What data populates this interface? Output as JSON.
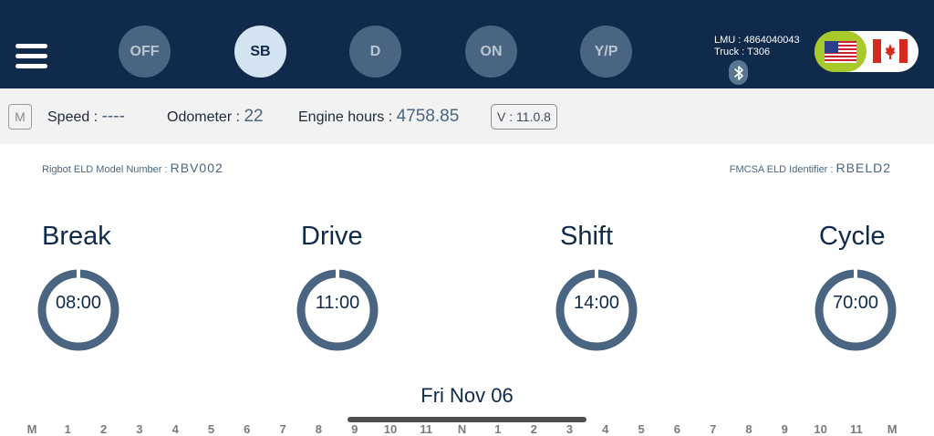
{
  "header": {
    "statuses": [
      {
        "label": "OFF",
        "active": false
      },
      {
        "label": "SB",
        "active": true
      },
      {
        "label": "D",
        "active": false
      },
      {
        "label": "ON",
        "active": false
      },
      {
        "label": "Y/P",
        "active": false
      }
    ],
    "lmu": "LMU : 4864040043",
    "truck": "Truck : T306",
    "colors": {
      "bar": "#0f2a4a",
      "active_flag_bg": "#a7c92a"
    }
  },
  "infobar": {
    "m_label": "M",
    "speed_label": "Speed :",
    "speed_value": "----",
    "odometer_label": "Odometer :",
    "odometer_value": "22",
    "engine_label": "Engine hours :",
    "engine_value": "4758.85",
    "version": "V : 11.0.8"
  },
  "model": {
    "model_label": "Rigbot ELD Model Number :",
    "model_value": "RBV002",
    "fmcsa_label": "FMCSA ELD Identifier :",
    "fmcsa_value": "RBELD2"
  },
  "clocks": [
    {
      "title": "Break",
      "value": "08:00"
    },
    {
      "title": "Drive",
      "value": "11:00"
    },
    {
      "title": "Shift",
      "value": "14:00"
    },
    {
      "title": "Cycle",
      "value": "70:00"
    }
  ],
  "date": "Fri Nov 06",
  "hours": [
    "M",
    "1",
    "2",
    "3",
    "4",
    "5",
    "6",
    "7",
    "8",
    "9",
    "10",
    "11",
    "N",
    "1",
    "2",
    "3",
    "4",
    "5",
    "6",
    "7",
    "8",
    "9",
    "10",
    "11",
    "M"
  ]
}
